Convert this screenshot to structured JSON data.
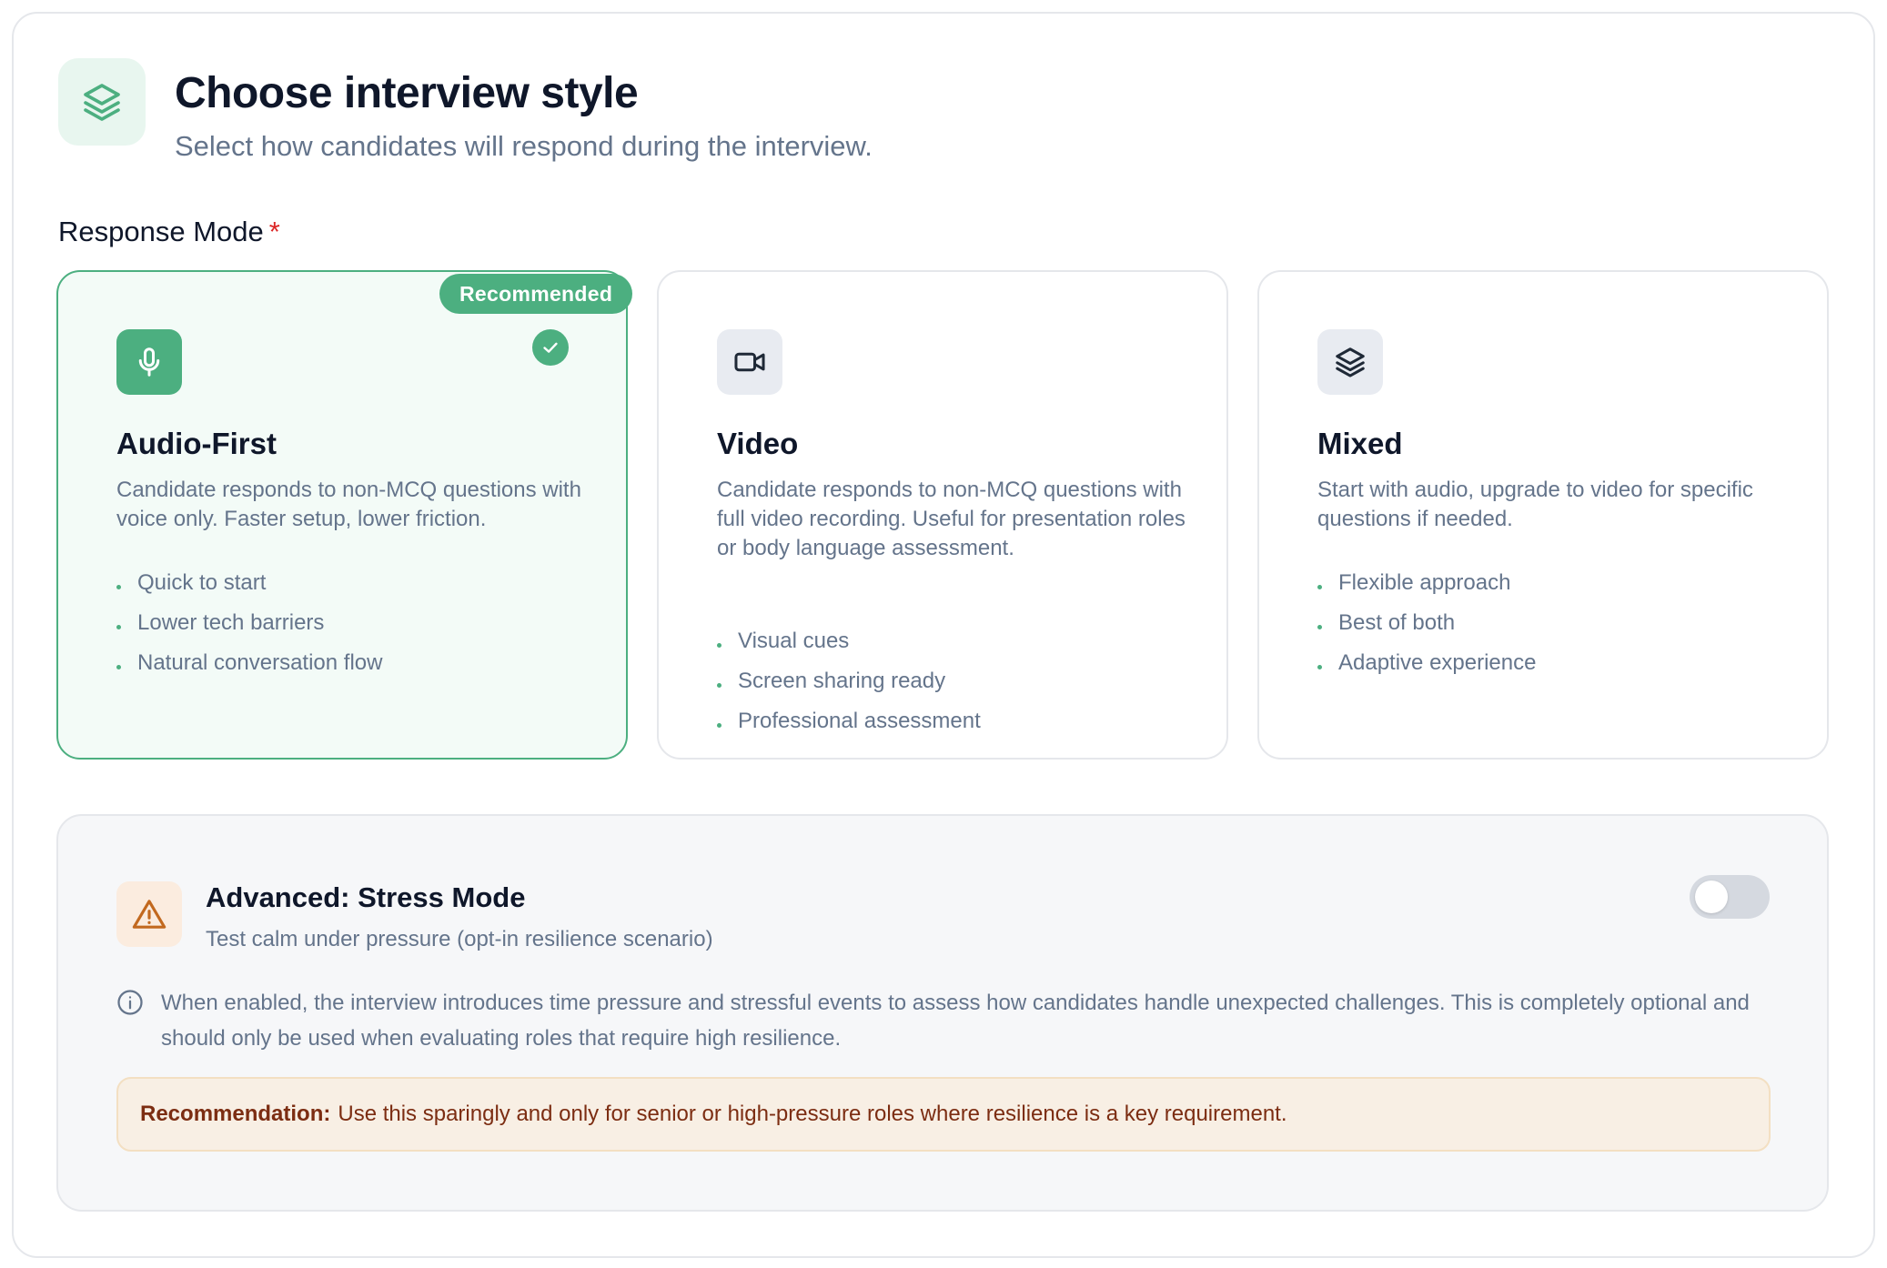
{
  "header": {
    "title": "Choose interview style",
    "subtitle": "Select how candidates will respond during the interview.",
    "icon": "layers-icon"
  },
  "response_mode": {
    "label": "Response Mode",
    "required_marker": "*",
    "selected": "audio-first",
    "badge": "Recommended",
    "cards": [
      {
        "id": "audio-first",
        "icon": "microphone-icon",
        "title": "Audio-First",
        "description": "Candidate responds to non-MCQ questions with voice only. Faster setup, lower friction.",
        "bullets": [
          "Quick to start",
          "Lower tech barriers",
          "Natural conversation flow"
        ]
      },
      {
        "id": "video",
        "icon": "video-camera-icon",
        "title": "Video",
        "description": "Candidate responds to non-MCQ questions with full video recording. Useful for presentation roles or body language assessment.",
        "bullets": [
          "Visual cues",
          "Screen sharing ready",
          "Professional assessment"
        ]
      },
      {
        "id": "mixed",
        "icon": "layers-icon",
        "title": "Mixed",
        "description": "Start with audio, upgrade to video for specific questions if needed.",
        "bullets": [
          "Flexible approach",
          "Best of both",
          "Adaptive experience"
        ]
      }
    ]
  },
  "advanced": {
    "icon": "warning-triangle-icon",
    "title": "Advanced: Stress Mode",
    "subtitle": "Test calm under pressure (opt-in resilience scenario)",
    "toggle_on": false,
    "info": "When enabled, the interview introduces time pressure and stressful events to assess how candidates handle unexpected challenges. This is completely optional and should only be used when evaluating roles that require high resilience.",
    "recommendation_label": "Recommendation:",
    "recommendation_text": "Use this sparingly and only for senior or high-pressure roles where resilience is a key requirement."
  },
  "colors": {
    "accent": "#4caf80",
    "warning": "#c2691f",
    "required": "#dc2626"
  }
}
